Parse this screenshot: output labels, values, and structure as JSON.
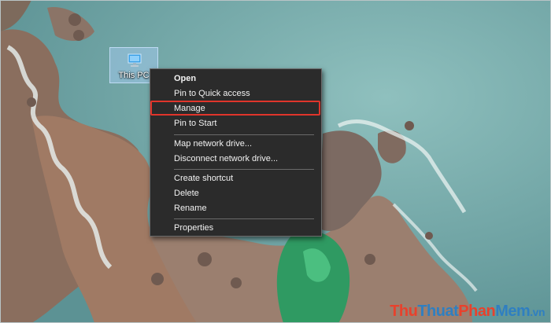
{
  "desktop": {
    "icon_label": "This PC"
  },
  "context_menu": {
    "items": [
      {
        "label": "Open",
        "bold": true
      },
      {
        "label": "Pin to Quick access"
      },
      {
        "label": "Manage",
        "highlighted": true
      },
      {
        "label": "Pin to Start"
      },
      {
        "label": "Map network drive..."
      },
      {
        "label": "Disconnect network drive..."
      },
      {
        "label": "Create shortcut"
      },
      {
        "label": "Delete"
      },
      {
        "label": "Rename"
      },
      {
        "label": "Properties"
      }
    ]
  },
  "watermark": {
    "part1": "Thu",
    "part2": "Thuat",
    "part3": "Phan",
    "part4": "Mem",
    "part5": ".vn"
  },
  "colors": {
    "menu_bg": "#2b2b2b",
    "highlight_border": "#e0352b",
    "sea": "#6fa3a4",
    "watermark_red": "#e8412c",
    "watermark_blue": "#2f7fc1"
  }
}
